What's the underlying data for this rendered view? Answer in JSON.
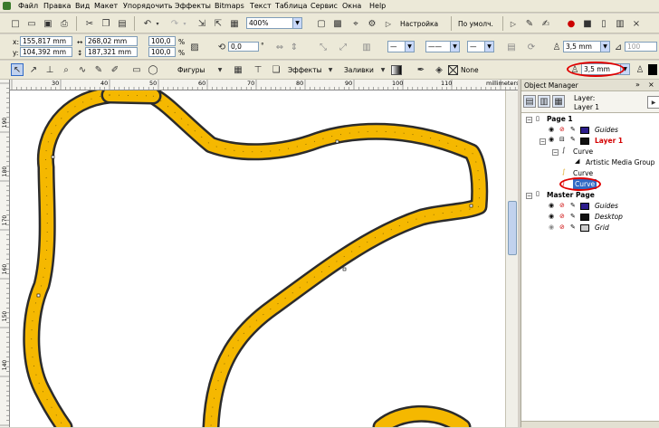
{
  "menu": [
    "Файл",
    "Правка",
    "Вид",
    "Макет",
    "Упорядочить",
    "Эффекты",
    "Bitmaps",
    "Текст",
    "Таблица",
    "Сервис",
    "Окна",
    "Help"
  ],
  "toolbar1": {
    "zoom": "400%",
    "snap_label": "Настройка",
    "default_label": "По умолч."
  },
  "props": {
    "x": "155,817 mm",
    "y": "104,392 mm",
    "w": "268,02 mm",
    "h": "187,321 mm",
    "sx": "100,0",
    "sy": "100,0",
    "pct": "%",
    "angle": "0,0",
    "outline": "3,5 mm",
    "right_val": "100"
  },
  "toolbox": {
    "shapes_label": "Фигуры",
    "effects_label": "Эффекты",
    "fills_label": "Заливки",
    "none_label": "None",
    "width_value": "3,5 mm"
  },
  "ruler": {
    "units": "millimeters",
    "h_ticks": [
      "30",
      "40",
      "50",
      "60",
      "70",
      "80",
      "90",
      "100",
      "110"
    ],
    "v_ticks": [
      "190",
      "180",
      "170",
      "160",
      "150",
      "140"
    ]
  },
  "panel": {
    "title": "Object Manager",
    "layer_label": "Layer:",
    "layer_value": "Layer 1",
    "tree": [
      {
        "label": "Page 1"
      },
      {
        "label": "Guides"
      },
      {
        "label": "Layer 1"
      },
      {
        "label": "Curve"
      },
      {
        "label": "Artistic Media Group"
      },
      {
        "label": "Curve"
      },
      {
        "label": "Curve"
      },
      {
        "label": "Master Page"
      },
      {
        "label": "Guides"
      },
      {
        "label": "Desktop"
      },
      {
        "label": "Grid"
      }
    ]
  },
  "colors": {
    "track": "#f5b800",
    "outline": "#2b2b2b",
    "layer_red": "#d40000",
    "selection": "#316ac5",
    "annotation": "#e00000"
  }
}
